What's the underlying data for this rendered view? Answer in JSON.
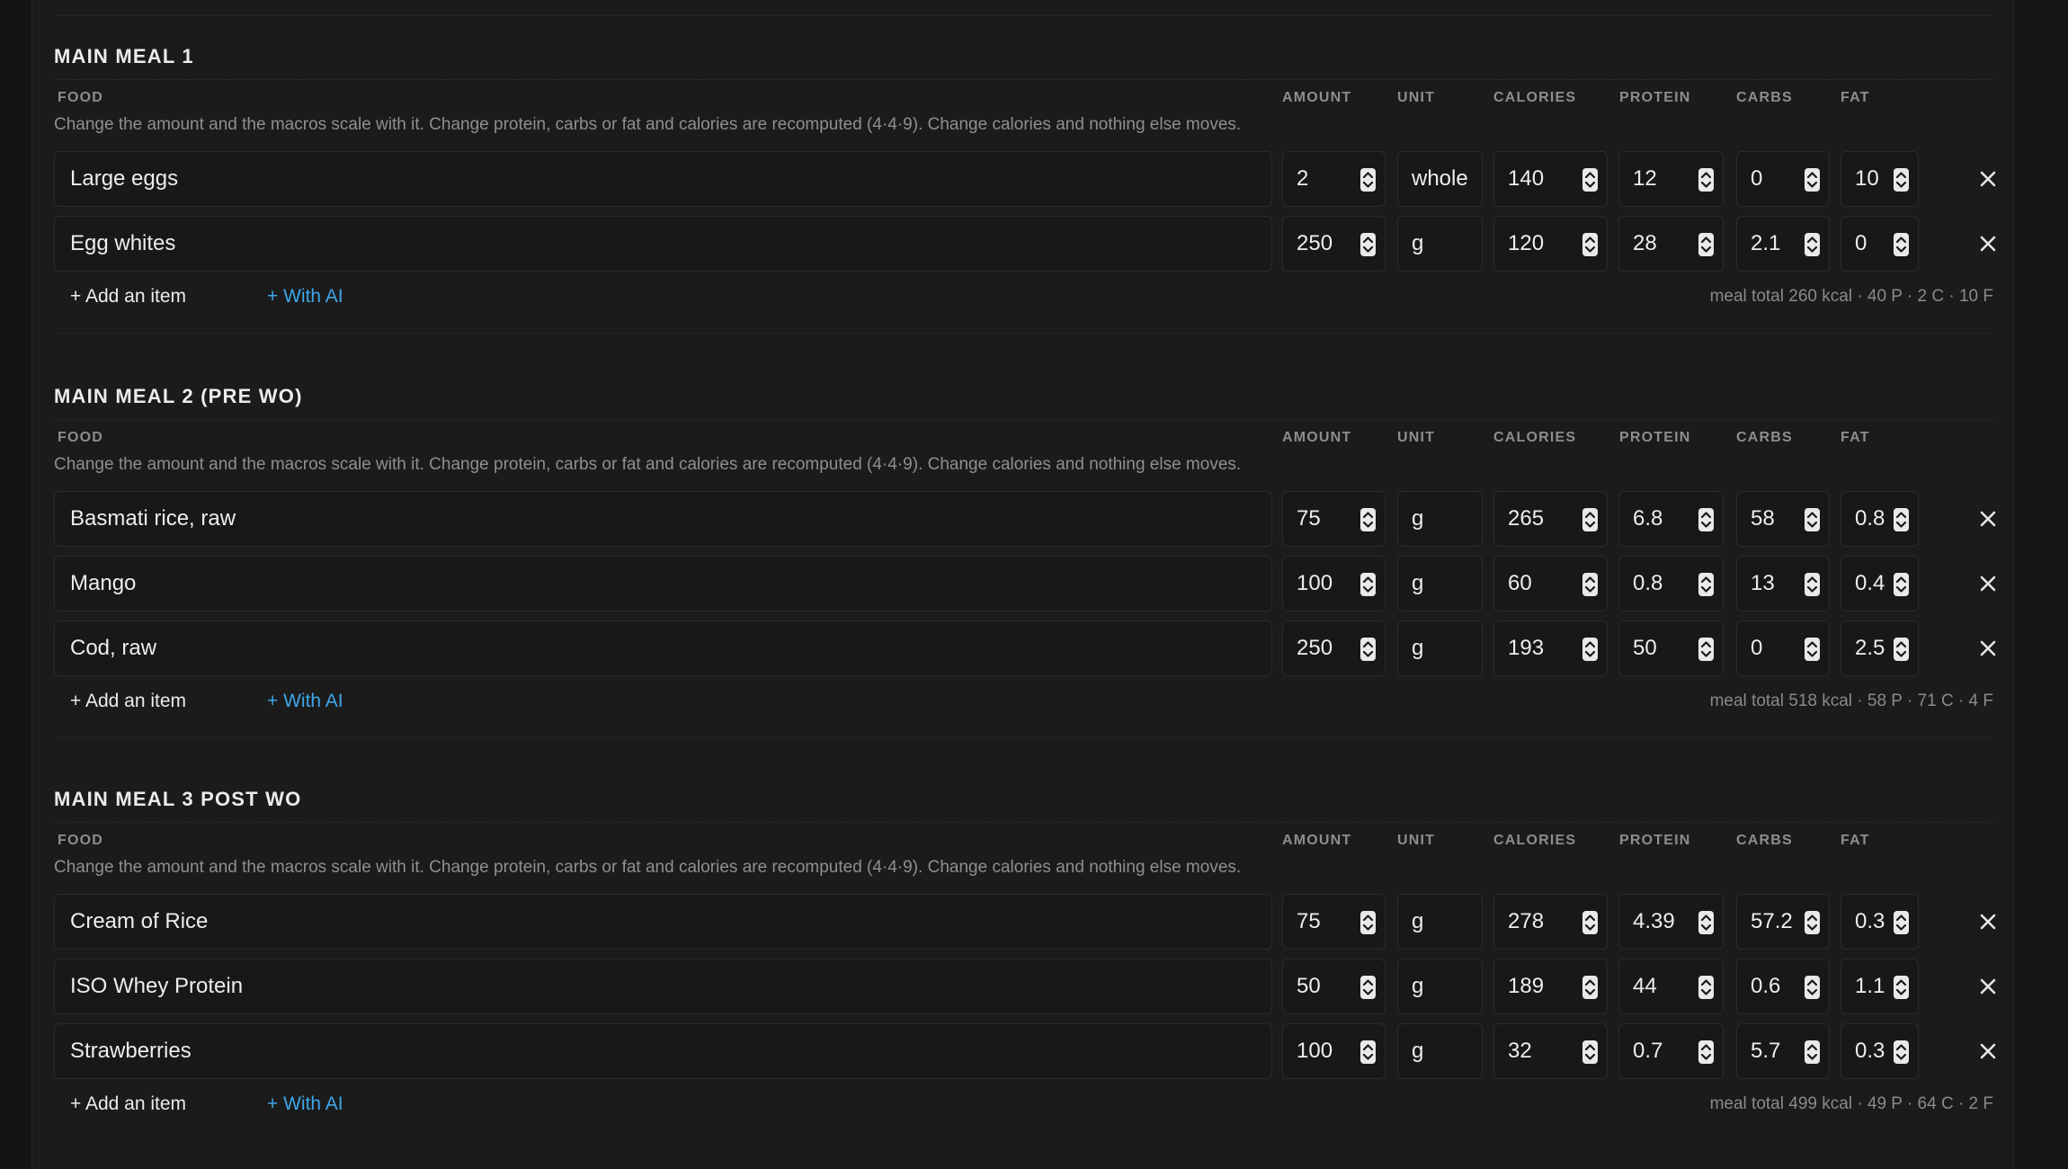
{
  "columns": {
    "food": "FOOD",
    "amount": "AMOUNT",
    "unit": "UNIT",
    "calories": "CALORIES",
    "protein": "PROTEIN",
    "carbs": "CARBS",
    "fat": "FAT"
  },
  "hint": "Change the amount and the macros scale with it. Change protein, carbs or fat and calories are recomputed (4·4·9). Change calories and nothing else moves.",
  "add_item_label": "+ Add an item",
  "with_ai_label": "+ With AI",
  "accent_color": "#3ea6e8",
  "meals": [
    {
      "title": "MAIN MEAL 1",
      "items": [
        {
          "food": "Large eggs",
          "amount": "2",
          "unit": "whole",
          "calories": "140",
          "protein": "12",
          "carbs": "0",
          "fat": "10"
        },
        {
          "food": "Egg whites",
          "amount": "250",
          "unit": "g",
          "calories": "120",
          "protein": "28",
          "carbs": "2.1",
          "fat": "0"
        }
      ],
      "total": "meal total 260 kcal · 40 P · 2 C · 10 F"
    },
    {
      "title": "MAIN MEAL 2 (PRE WO)",
      "items": [
        {
          "food": "Basmati rice, raw",
          "amount": "75",
          "unit": "g",
          "calories": "265",
          "protein": "6.8",
          "carbs": "58",
          "fat": "0.8"
        },
        {
          "food": "Mango",
          "amount": "100",
          "unit": "g",
          "calories": "60",
          "protein": "0.8",
          "carbs": "13",
          "fat": "0.4"
        },
        {
          "food": "Cod, raw",
          "amount": "250",
          "unit": "g",
          "calories": "193",
          "protein": "50",
          "carbs": "0",
          "fat": "2.5"
        }
      ],
      "total": "meal total 518 kcal · 58 P · 71 C · 4 F"
    },
    {
      "title": "MAIN MEAL 3 POST WO",
      "items": [
        {
          "food": "Cream of Rice",
          "amount": "75",
          "unit": "g",
          "calories": "278",
          "protein": "4.39",
          "carbs": "57.2",
          "fat": "0.3"
        },
        {
          "food": "ISO Whey Protein",
          "amount": "50",
          "unit": "g",
          "calories": "189",
          "protein": "44",
          "carbs": "0.6",
          "fat": "1.1"
        },
        {
          "food": "Strawberries",
          "amount": "100",
          "unit": "g",
          "calories": "32",
          "protein": "0.7",
          "carbs": "5.7",
          "fat": "0.3"
        }
      ],
      "total": "meal total 499 kcal · 49 P · 64 C · 2 F"
    }
  ]
}
